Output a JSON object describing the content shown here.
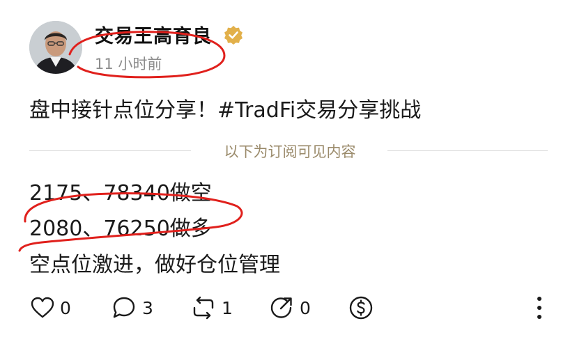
{
  "post": {
    "author": "交易王高育良",
    "verified_badge": "verified-badge-icon",
    "timestamp": "11 小时前",
    "text": "盘中接针点位分享！#TradFi交易分享挑战",
    "divider_label": "以下为订阅可见内容",
    "content_lines": [
      "2175、78340做空",
      "2080、76250做多",
      "空点位激进，做好仓位管理"
    ]
  },
  "actions": {
    "like_count": "0",
    "comment_count": "3",
    "repost_count": "1",
    "share_count": "0"
  },
  "colors": {
    "badge": "#e2b04a",
    "annotation": "#e0201c",
    "divider_text": "#9a8a6a"
  }
}
